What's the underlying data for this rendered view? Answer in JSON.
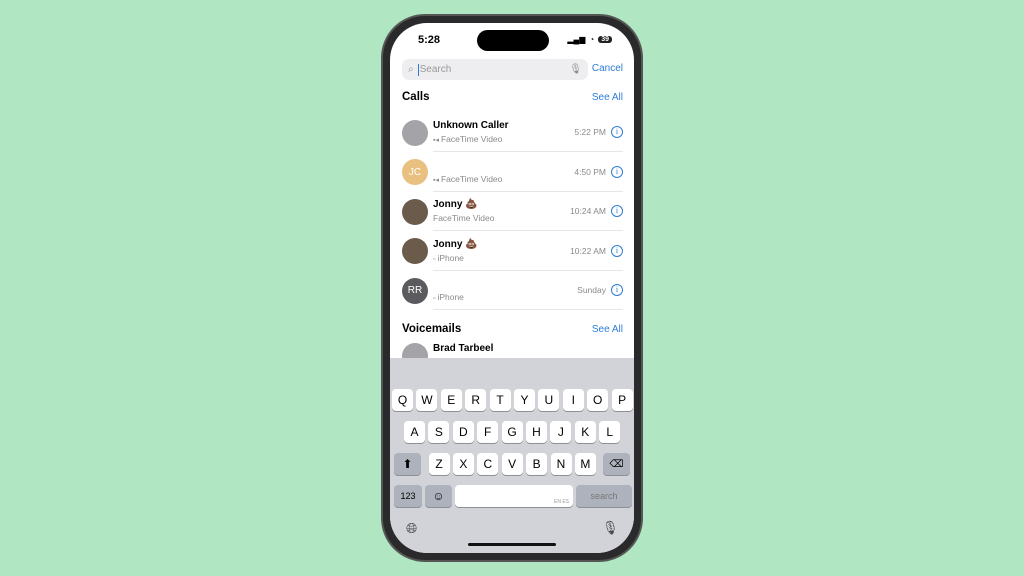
{
  "status": {
    "time": "5:28",
    "battery": "39"
  },
  "search": {
    "placeholder": "Search",
    "cancel": "Cancel"
  },
  "calls": {
    "title": "Calls",
    "see_all": "See All",
    "items": [
      {
        "name": "Unknown Caller",
        "type": "FaceTime Video",
        "time": "5:22 PM",
        "avatar": "",
        "avatar_color": "#a3a3a8",
        "icon": "video-icon"
      },
      {
        "name": "",
        "type": "FaceTime Video",
        "time": "4:50 PM",
        "avatar": "JC",
        "avatar_color": "#e9c07f",
        "icon": "video-icon"
      },
      {
        "name": "Jonny 💩",
        "type": "FaceTime Video",
        "time": "10:24 AM",
        "avatar": "",
        "avatar_color": "#6b5b4a",
        "icon": ""
      },
      {
        "name": "Jonny 💩",
        "type": "iPhone",
        "time": "10:22 AM",
        "avatar": "",
        "avatar_color": "#6b5b4a",
        "icon": "phone-icon"
      },
      {
        "name": "",
        "type": "iPhone",
        "time": "Sunday",
        "avatar": "RR",
        "avatar_color": "#5b5b5f",
        "icon": "phone-icon"
      }
    ]
  },
  "voicemails": {
    "title": "Voicemails",
    "see_all": "See All",
    "first": "Brad Tarbeel"
  },
  "keyboard": {
    "rows": [
      [
        "Q",
        "W",
        "E",
        "R",
        "T",
        "Y",
        "U",
        "I",
        "O",
        "P"
      ],
      [
        "A",
        "S",
        "D",
        "F",
        "G",
        "H",
        "J",
        "K",
        "L"
      ],
      [
        "Z",
        "X",
        "C",
        "V",
        "B",
        "N",
        "M"
      ]
    ],
    "numbers": "123",
    "space_lang": "EN ES",
    "search": "search"
  }
}
